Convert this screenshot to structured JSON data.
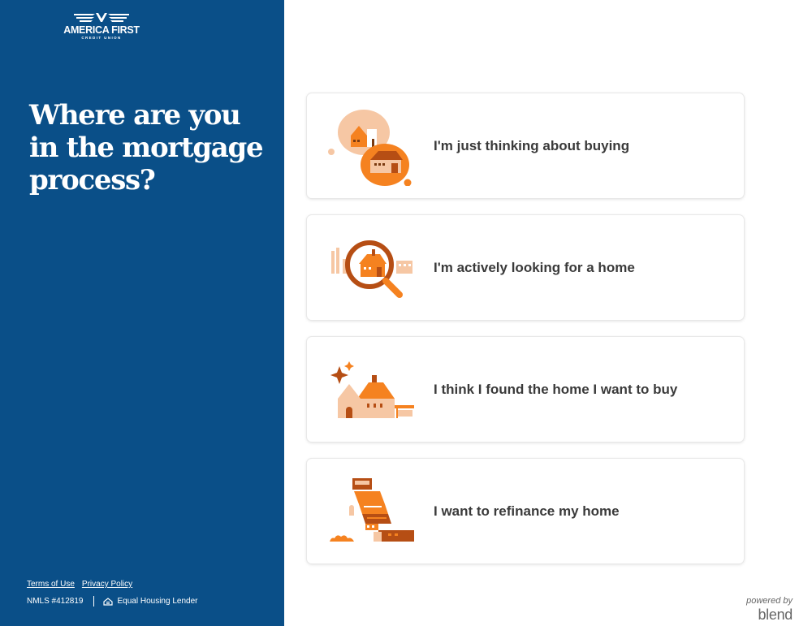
{
  "brand": {
    "name": "AMERICA FIRST",
    "subtitle": "CREDIT UNION"
  },
  "sidebar": {
    "headline": "Where are you in the mortgage process?",
    "footer": {
      "terms": "Terms of Use",
      "privacy": "Privacy Policy",
      "nmls": "NMLS #412819",
      "equal_housing": "Equal Housing Lender"
    },
    "bg_color": "#0a4f88"
  },
  "options": [
    {
      "label": "I'm just thinking about buying",
      "icon": "thinking-house-illustration"
    },
    {
      "label": "I'm actively looking for a home",
      "icon": "magnifier-house-illustration"
    },
    {
      "label": "I think I found the home I want to buy",
      "icon": "sparkle-house-illustration"
    },
    {
      "label": "I want to refinance my home",
      "icon": "refinance-illustration"
    }
  ],
  "powered": {
    "by": "powered by",
    "brand": "blend"
  },
  "colors": {
    "accent_orange": "#f58220",
    "accent_dark": "#b64e14",
    "accent_peach": "#f6c7a4"
  }
}
